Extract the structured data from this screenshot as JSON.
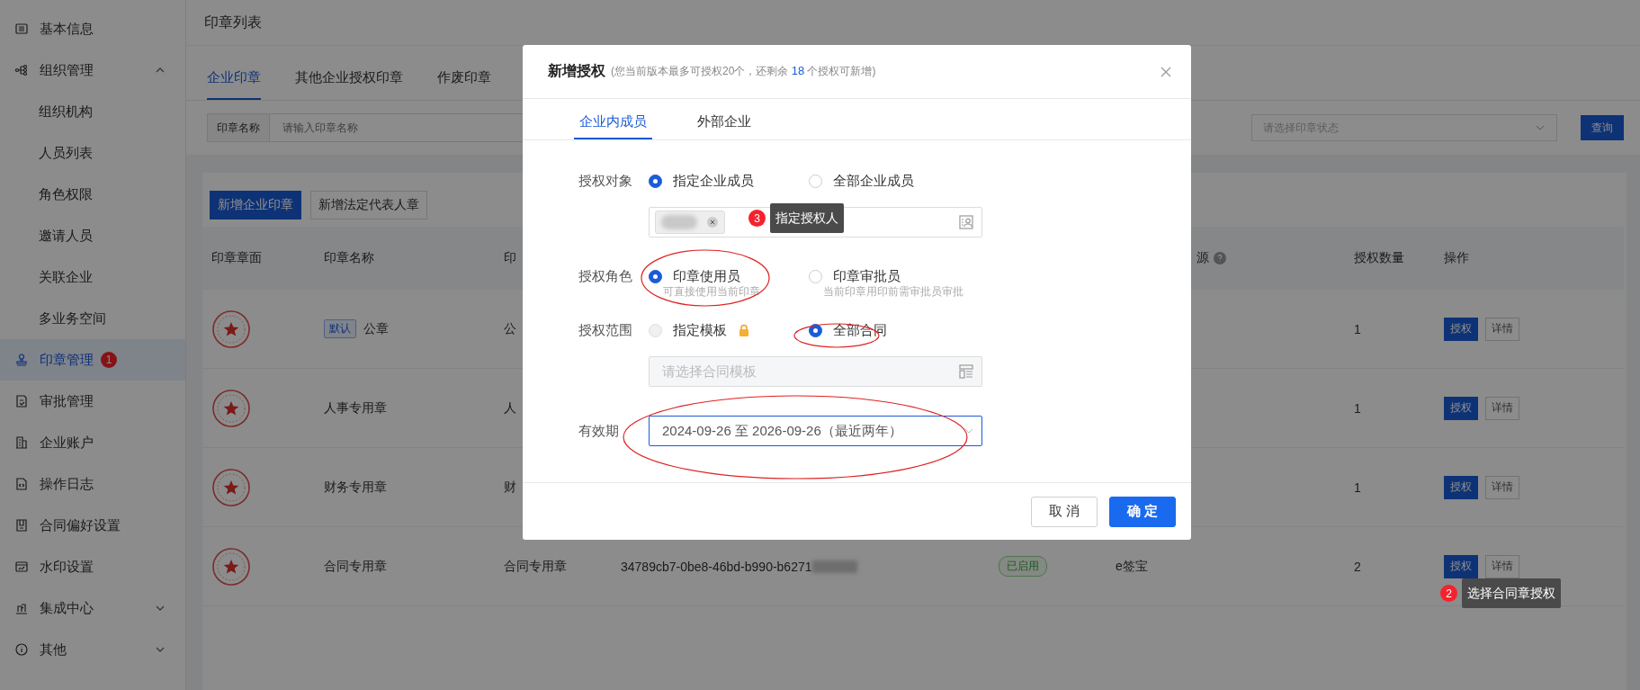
{
  "sidebar": {
    "items": [
      {
        "label": "基本信息",
        "selected": false
      },
      {
        "label": "组织管理",
        "selected": false,
        "expanded": true,
        "children": [
          {
            "label": "组织机构",
            "selected": false
          },
          {
            "label": "人员列表",
            "selected": false
          },
          {
            "label": "角色权限",
            "selected": false
          },
          {
            "label": "邀请人员",
            "selected": false
          },
          {
            "label": "关联企业",
            "selected": false
          },
          {
            "label": "多业务空间",
            "selected": false
          }
        ]
      },
      {
        "label": "印章管理",
        "selected": true,
        "badge": "1"
      },
      {
        "label": "审批管理",
        "selected": false
      },
      {
        "label": "企业账户",
        "selected": false
      },
      {
        "label": "操作日志",
        "selected": false
      },
      {
        "label": "合同偏好设置",
        "selected": false
      },
      {
        "label": "水印设置",
        "selected": false
      },
      {
        "label": "集成中心",
        "selected": false,
        "expanded": false
      },
      {
        "label": "其他",
        "selected": false,
        "expanded": false
      }
    ]
  },
  "page": {
    "title": "印章列表",
    "tabs": [
      {
        "label": "企业印章",
        "selected": true
      },
      {
        "label": "其他企业授权印章",
        "selected": false
      },
      {
        "label": "作废印章",
        "selected": false
      }
    ],
    "filters": {
      "name_label": "印章名称",
      "name_placeholder": "请输入印章名称",
      "status_placeholder": "请选择印章状态",
      "search_button": "查询"
    },
    "buttons": [
      {
        "label": "新增企业印章",
        "kind": "primary"
      },
      {
        "label": "新增法定代表人章",
        "kind": "default"
      }
    ],
    "table": {
      "columns": {
        "face": "印章章面",
        "name": "印章名称",
        "column_3": "印",
        "source": "源",
        "count": "授权数量",
        "actions": "操作"
      },
      "rows": [
        {
          "tag": "默认",
          "name": "公章",
          "column_3": "公",
          "count": "1",
          "actions": [
            "授权",
            "详情"
          ]
        },
        {
          "name": "人事专用章",
          "column_3": "人",
          "count": "1",
          "actions": [
            "授权",
            "详情"
          ]
        },
        {
          "name": "财务专用章",
          "column_3": "财",
          "count": "1",
          "actions": [
            "授权",
            "详情"
          ]
        },
        {
          "name": "合同专用章",
          "column_3": "合同专用章",
          "seal_id": "34789cb7-0be8-46bd-b990-b6271",
          "status": "已启用",
          "source": "e签宝",
          "count": "2",
          "actions": [
            "授权",
            "详情"
          ]
        }
      ]
    }
  },
  "dialog": {
    "title": "新增授权",
    "note": "(您当前版本最多可授权20个，还剩余 ",
    "note_count": "18",
    "note_end": " 个授权可新增)",
    "tabs": [
      {
        "label": "企业内成员",
        "selected": true
      },
      {
        "label": "外部企业",
        "selected": false
      }
    ],
    "fields": [
      {
        "kind": "radio",
        "label": "授权对象",
        "options": [
          {
            "label": "指定企业成员",
            "selected": true,
            "disabled": false
          },
          {
            "label": "全部企业成员",
            "selected": false,
            "disabled": false
          }
        ],
        "picker": {
          "kind": "members"
        }
      },
      {
        "kind": "radio",
        "label": "授权角色",
        "options": [
          {
            "label": "印章使用员",
            "hint": "可直接使用当前印章",
            "selected": true,
            "disabled": false
          },
          {
            "label": "印章审批员",
            "hint": "当前印章用印前需审批员审批",
            "selected": false,
            "disabled": false
          }
        ]
      },
      {
        "kind": "radio",
        "label": "授权范围",
        "options": [
          {
            "label": "指定模板",
            "selected": false,
            "disabled": true,
            "locked": true
          },
          {
            "label": "全部合同",
            "selected": true,
            "disabled": false,
            "locked": false
          }
        ],
        "picker": {
          "kind": "template",
          "placeholder": "请选择合同模板",
          "disabled": true
        }
      },
      {
        "kind": "select",
        "label": "有效期",
        "value": "2024-09-26 至 2026-09-26（最近两年）",
        "focused": true
      }
    ],
    "cancel": "取 消",
    "confirm": "确 定"
  },
  "annotations": [
    {
      "number": "3",
      "text": "指定授权人"
    },
    {
      "number": "2",
      "text": "选择合同章授权"
    }
  ]
}
